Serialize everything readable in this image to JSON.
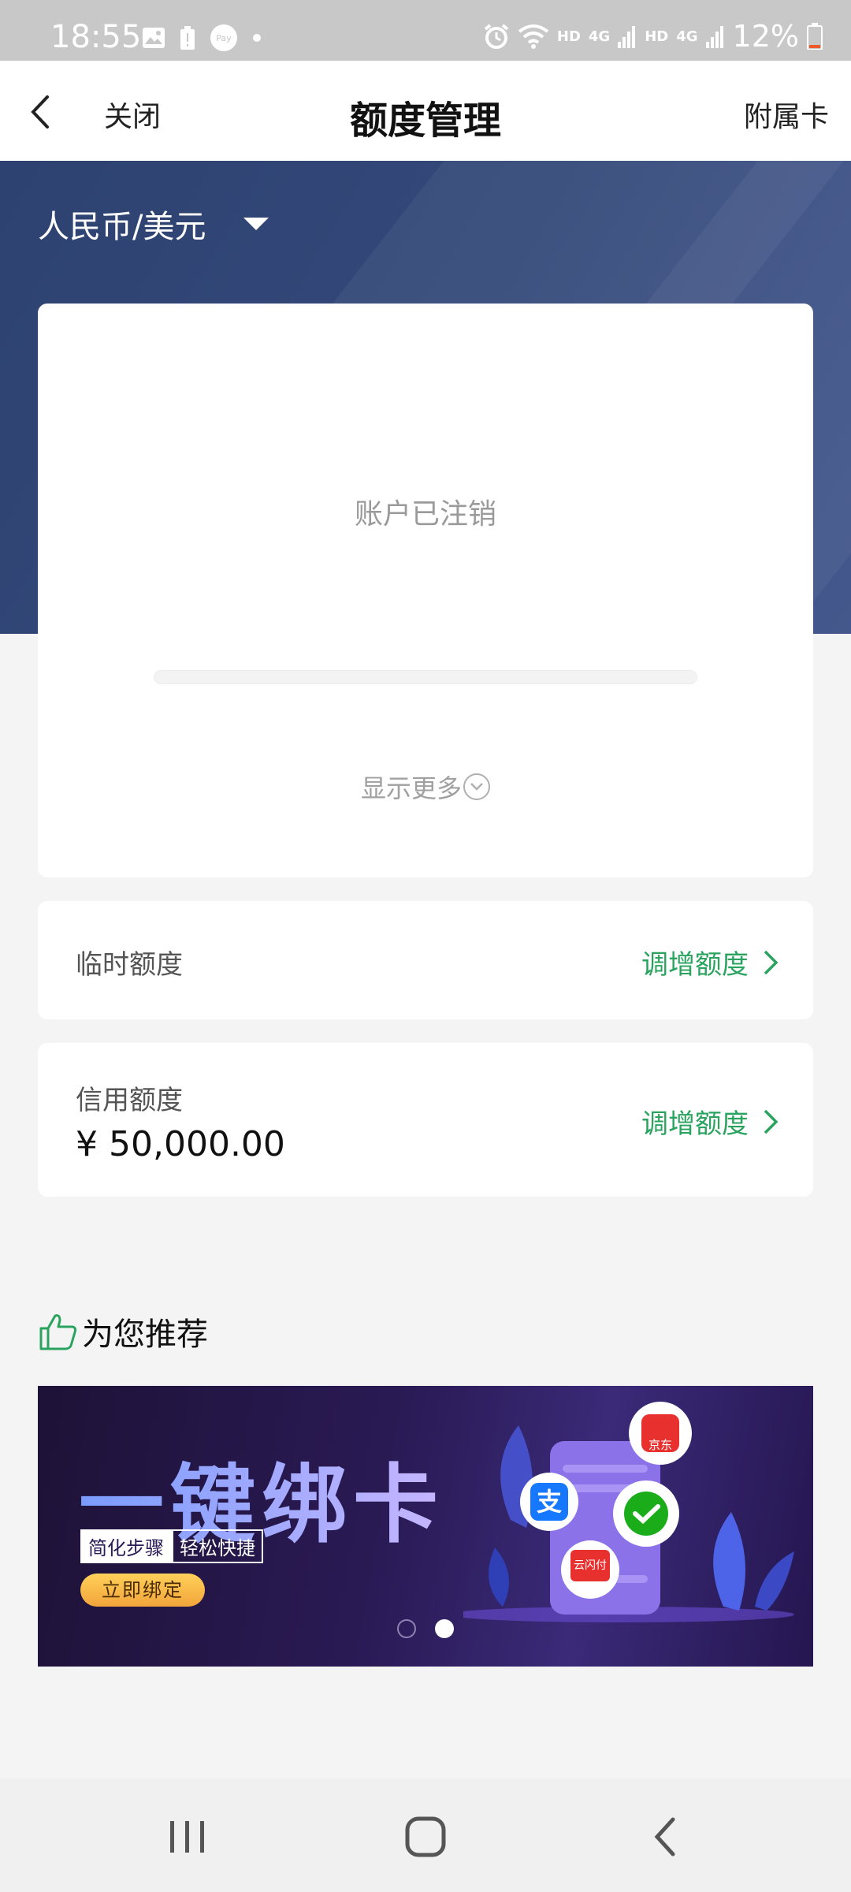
{
  "status_bar": {
    "time": "18:55",
    "hd1": "HD",
    "net1": "4G",
    "hd2": "HD",
    "net2": "4G",
    "battery": "12%",
    "pay_badge": "Pay"
  },
  "nav": {
    "close_label": "关闭",
    "title": "额度管理",
    "right_label": "附属卡"
  },
  "currency": {
    "selected": "人民币/美元"
  },
  "account": {
    "status_text": "账户已注销",
    "progress": 0,
    "show_more_label": "显示更多"
  },
  "temp_limit": {
    "label": "临时额度",
    "action_label": "调增额度"
  },
  "credit_limit": {
    "label": "信用额度",
    "amount": "¥ 50,000.00",
    "action_label": "调增额度"
  },
  "recommend": {
    "title": "为您推荐"
  },
  "banner": {
    "title": "一键绑卡",
    "tag1": "简化步骤",
    "tag2": "轻松快捷",
    "button_label": "立即绑定",
    "jd_label": "京东",
    "alipay_label": "支",
    "yunshanfu_label": "云闪付",
    "active_slide": 2,
    "slide_count": 2
  },
  "colors": {
    "accent_green": "#2aa35f",
    "hero_blue": "#34497a",
    "banner_purple": "#2a1a55"
  }
}
